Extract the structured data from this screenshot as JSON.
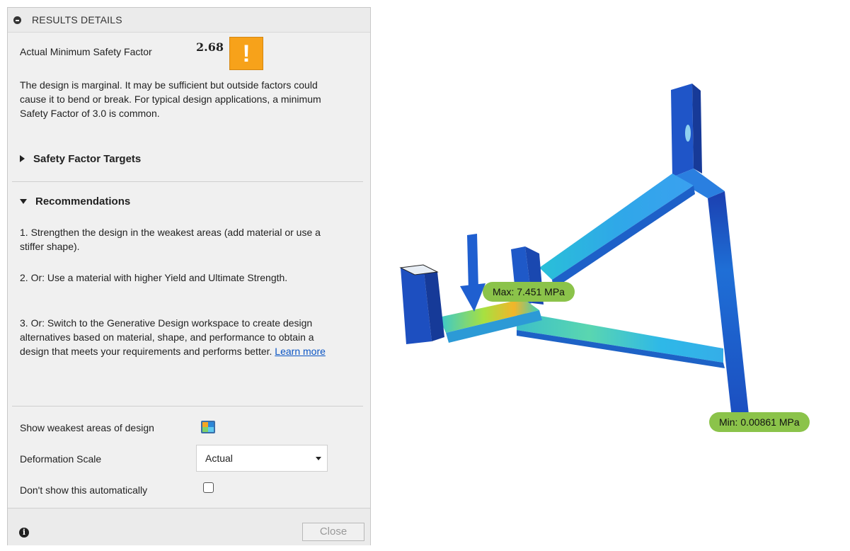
{
  "panel": {
    "title": "RESULTS DETAILS",
    "safety_factor_label": "Actual Minimum Safety Factor",
    "safety_factor_value": "2.68",
    "warning_glyph": "!",
    "description": "The design is marginal. It may be sufficient but outside factors could cause it to bend or break. For typical design applications, a minimum Safety Factor of 3.0 is common.",
    "targets_section": "Safety Factor Targets",
    "recommendations_section": "Recommendations",
    "rec1": "1. Strengthen the design in the weakest areas (add material or use a stiffer shape).",
    "rec2": "2. Or: Use a material with higher Yield and Ultimate Strength.",
    "rec3": "3. Or: Switch to the Generative Design workspace to create design alternatives based on material, shape, and performance to obtain a design that meets your requirements and performs better.",
    "learn_more": "Learn more",
    "weakest_label": "Show weakest areas of design",
    "deformation_label": "Deformation Scale",
    "deformation_value": "Actual",
    "dont_show_label": "Don't show this automatically",
    "dont_show_checked": false,
    "info_glyph": "i",
    "close_label": "Close"
  },
  "viewport": {
    "max_label": "Max: 7.451 MPa",
    "min_label": "Min: 0.00861 MPa"
  },
  "icons": {
    "header": "collapse-icon",
    "warning": "warning-icon",
    "weakest": "weakest-areas-icon",
    "info": "info-icon",
    "dropdown": "chevron-down-icon",
    "load_arrow": "load-arrow-icon"
  },
  "colors": {
    "warning": "#f7a21a",
    "label_tag": "#8bc34a",
    "link": "#0b55c4"
  }
}
